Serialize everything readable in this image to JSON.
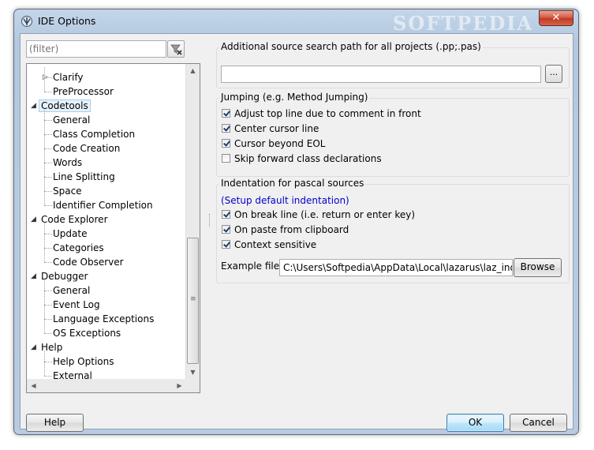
{
  "window": {
    "title": "IDE Options",
    "watermark": "SOFTPEDIA",
    "close_glyph": "✕"
  },
  "filter": {
    "placeholder": "(filter)"
  },
  "tree": [
    {
      "label": "Clarify",
      "level": 2,
      "expander": "▷"
    },
    {
      "label": "PreProcessor",
      "level": 2
    },
    {
      "label": "Codetools",
      "level": 1,
      "expander": "◢",
      "selected": true
    },
    {
      "label": "General",
      "level": 2
    },
    {
      "label": "Class Completion",
      "level": 2
    },
    {
      "label": "Code Creation",
      "level": 2
    },
    {
      "label": "Words",
      "level": 2
    },
    {
      "label": "Line Splitting",
      "level": 2
    },
    {
      "label": "Space",
      "level": 2
    },
    {
      "label": "Identifier Completion",
      "level": 2
    },
    {
      "label": "Code Explorer",
      "level": 1,
      "expander": "◢"
    },
    {
      "label": "Update",
      "level": 2
    },
    {
      "label": "Categories",
      "level": 2
    },
    {
      "label": "Code Observer",
      "level": 2
    },
    {
      "label": "Debugger",
      "level": 1,
      "expander": "◢"
    },
    {
      "label": "General",
      "level": 2
    },
    {
      "label": "Event Log",
      "level": 2
    },
    {
      "label": "Language Exceptions",
      "level": 2
    },
    {
      "label": "OS Exceptions",
      "level": 2
    },
    {
      "label": "Help",
      "level": 1,
      "expander": "◢"
    },
    {
      "label": "Help Options",
      "level": 2
    },
    {
      "label": "External",
      "level": 2
    }
  ],
  "search_path": {
    "title": "Additional source search path for all projects (.pp;.pas)",
    "value": "",
    "browse_label": "..."
  },
  "jumping": {
    "title": "Jumping (e.g. Method Jumping)",
    "options": [
      {
        "label": "Adjust top line due to comment in front",
        "checked": true
      },
      {
        "label": "Center cursor line",
        "checked": true
      },
      {
        "label": "Cursor beyond EOL",
        "checked": true
      },
      {
        "label": "Skip forward class declarations",
        "checked": false
      }
    ]
  },
  "indentation": {
    "title": "Indentation for pascal sources",
    "link": "(Setup default indentation)",
    "options": [
      {
        "label": "On break line (i.e. return or enter key)",
        "checked": true
      },
      {
        "label": "On paste from clipboard",
        "checked": true
      },
      {
        "label": "Context sensitive",
        "checked": true
      }
    ],
    "example_label": "Example file:",
    "example_value": "C:\\Users\\Softpedia\\AppData\\Local\\lazarus\\laz_indentation.pas",
    "browse_label": "Browse"
  },
  "buttons": {
    "help": "Help",
    "ok": "OK",
    "cancel": "Cancel"
  },
  "scrollbar": {
    "up": "▲",
    "down": "▼",
    "left": "◀",
    "right": "▶",
    "grip": "≡"
  },
  "colors": {
    "link": "#0000cc",
    "selection": "#e5f1fb",
    "default_button": "#bee6fd"
  }
}
